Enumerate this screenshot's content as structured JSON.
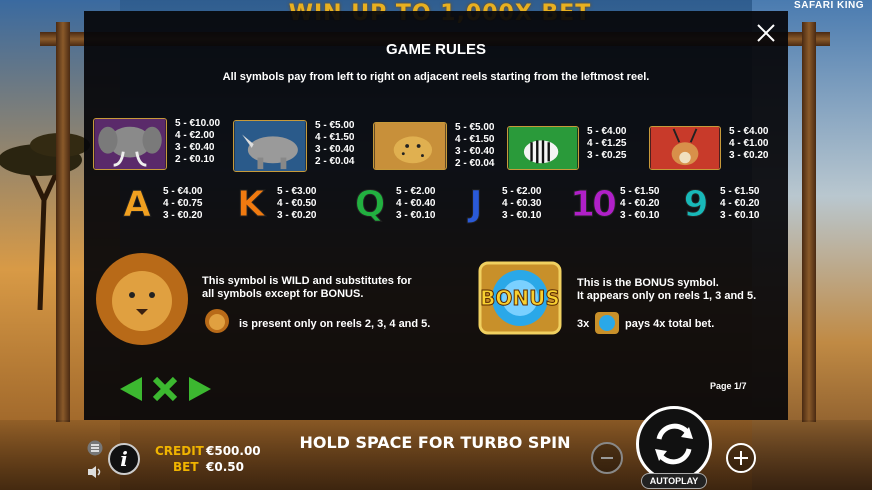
{
  "game": {
    "banner": "WIN UP TO 1,000X BET",
    "logo": "SAFARI KING"
  },
  "rules": {
    "title": "GAME RULES",
    "intro": "All symbols pay from left to right on adjacent reels starting from the leftmost reel.",
    "close_icon": "close-icon",
    "animal_symbols": [
      {
        "name": "elephant",
        "pays": [
          "5 - €10.00",
          "4 - €2.00",
          "3 - €0.40",
          "2 - €0.10"
        ]
      },
      {
        "name": "rhino",
        "pays": [
          "5 - €5.00",
          "4 - €1.50",
          "3 - €0.40",
          "2 - €0.04"
        ]
      },
      {
        "name": "cheetah",
        "pays": [
          "5 - €5.00",
          "4 - €1.50",
          "3 - €0.40",
          "2 - €0.04"
        ]
      },
      {
        "name": "zebra",
        "pays": [
          "5 - €4.00",
          "4 - €1.25",
          "3 - €0.25"
        ]
      },
      {
        "name": "antelope",
        "pays": [
          "5 - €4.00",
          "4 - €1.00",
          "3 - €0.20"
        ]
      }
    ],
    "card_symbols": [
      {
        "glyph": "A",
        "color": "#f0a020",
        "pays": [
          "5 - €4.00",
          "4 - €0.75",
          "3 - €0.20"
        ]
      },
      {
        "glyph": "K",
        "color": "#f07a10",
        "pays": [
          "5 - €3.00",
          "4 - €0.50",
          "3 - €0.20"
        ]
      },
      {
        "glyph": "Q",
        "color": "#22b040",
        "pays": [
          "5 - €2.00",
          "4 - €0.40",
          "3 - €0.10"
        ]
      },
      {
        "glyph": "J",
        "color": "#2a5ad8",
        "pays": [
          "5 - €2.00",
          "4 - €0.30",
          "3 - €0.10"
        ]
      },
      {
        "glyph": "10",
        "color": "#b020c8",
        "pays": [
          "5 - €1.50",
          "4 - €0.20",
          "3 - €0.10"
        ]
      },
      {
        "glyph": "9",
        "color": "#18b8b8",
        "pays": [
          "5 - €1.50",
          "4 - €0.20",
          "3 - €0.10"
        ]
      }
    ],
    "wild": {
      "line1": "This symbol is WILD and substitutes for",
      "line2": "all symbols except for BONUS.",
      "reels_text": "is present only on reels 2, 3, 4 and 5."
    },
    "bonus": {
      "badge": "BONUS",
      "line1": "This is the BONUS symbol.",
      "line2": "It appears only on reels 1, 3 and 5.",
      "prefix": "3x",
      "suffix": "pays 4x total bet."
    },
    "page": "Page 1/7"
  },
  "controls": {
    "credit_label": "CREDIT",
    "credit_value": "€500.00",
    "bet_label": "BET",
    "bet_value": "€0.50",
    "turbo_hint": "HOLD SPACE FOR TURBO SPIN",
    "autoplay_label": "AUTOPLAY",
    "info_glyph": "i"
  },
  "colors": {
    "overlay": "#060608",
    "credit_label": "#f0b400",
    "nav_green": "#3cb830",
    "frame": "#8a5a2a"
  }
}
